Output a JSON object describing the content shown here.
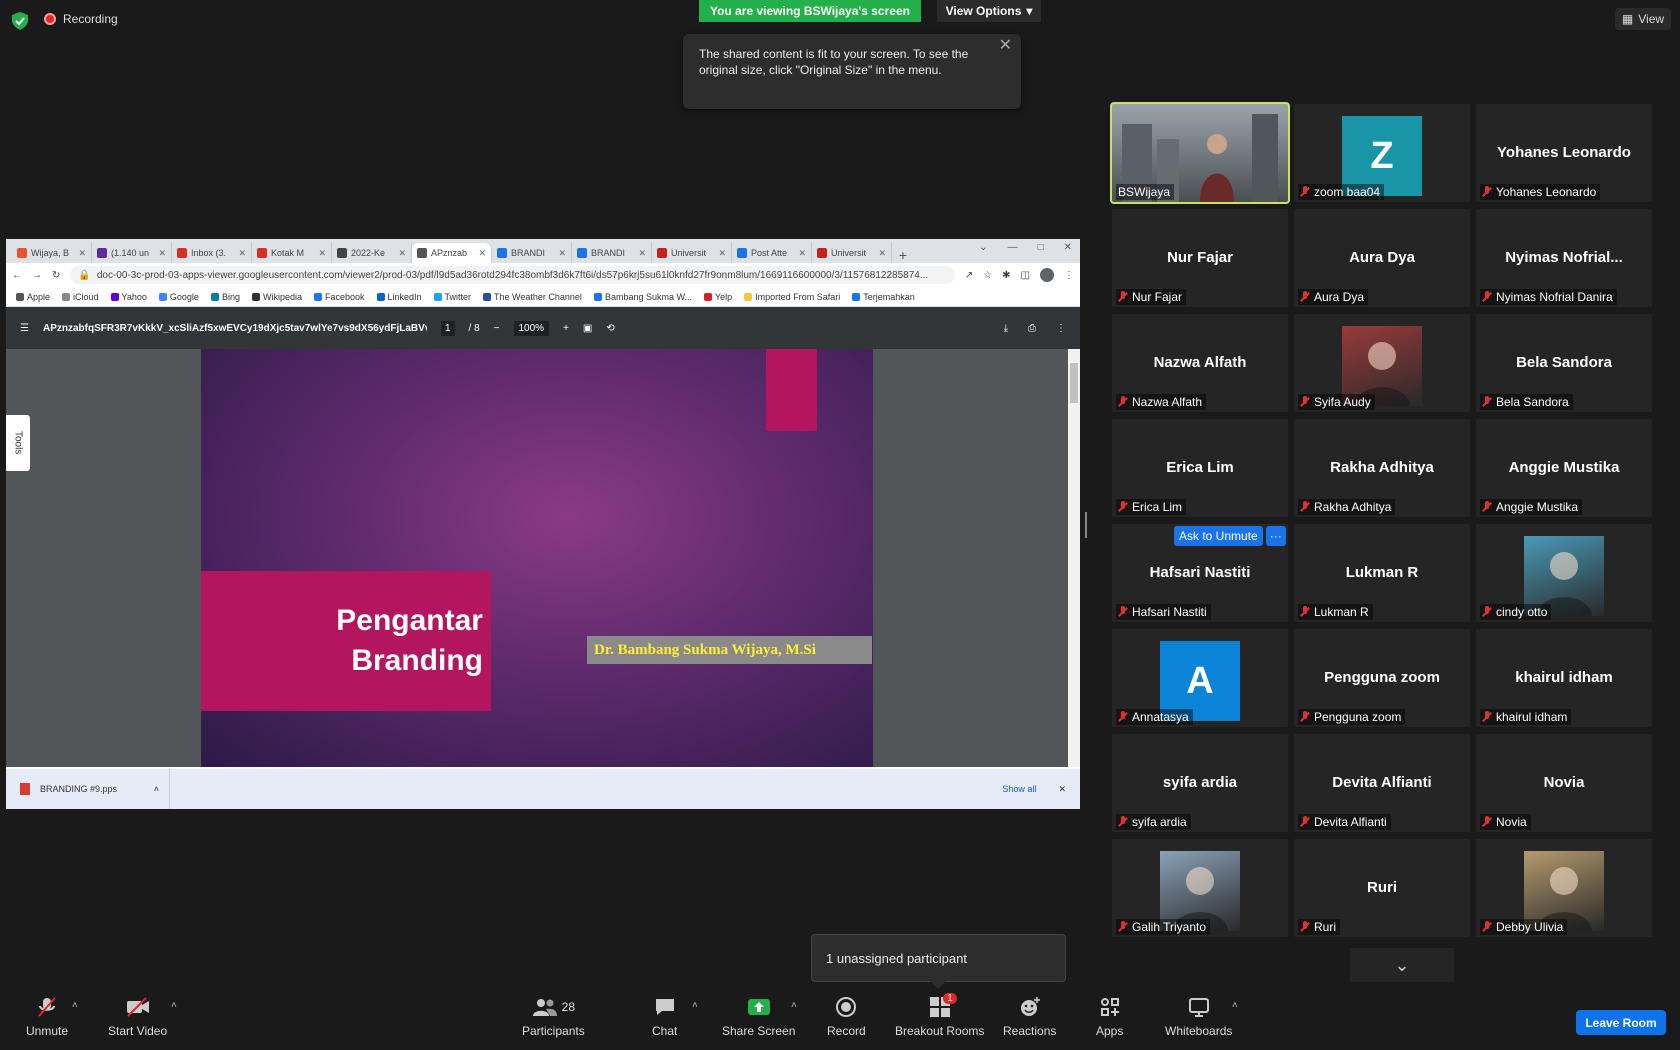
{
  "top": {
    "recording": "Recording",
    "banner": "You are viewing BSWijaya's screen",
    "view_options": "View Options",
    "tooltip": "The shared content is fit to your screen. To see the original size, click \"Original Size\" in the menu.",
    "view": "View"
  },
  "browser": {
    "tabs": [
      {
        "label": "Wijaya, B",
        "color": "#e4572e"
      },
      {
        "label": "(1.140 un",
        "color": "#5b2ca0"
      },
      {
        "label": "Inbox (3.",
        "color": "#d93025"
      },
      {
        "label": "Kotak M",
        "color": "#d93025"
      },
      {
        "label": "2022-Ke",
        "color": "#444444"
      },
      {
        "label": "APznzab",
        "color": "#555555"
      },
      {
        "label": "BRANDI",
        "color": "#1a73e8"
      },
      {
        "label": "BRANDI",
        "color": "#1a73e8"
      },
      {
        "label": "Universit",
        "color": "#c5221f"
      },
      {
        "label": "Post Atte",
        "color": "#1a73e8"
      },
      {
        "label": "Universit",
        "color": "#c5221f"
      }
    ],
    "url": "doc-00-3c-prod-03-apps-viewer.googleusercontent.com/viewer2/prod-03/pdf/l9d5ad36rotd294fc38ombf3d6k7ft6i/ds57p6krj5su61l0knfd27fr9onm8lum/1669116600000/3/11576812285874...",
    "bookmarks": [
      "Apple",
      "iCloud",
      "Yahoo",
      "Google",
      "Bing",
      "Wikipedia",
      "Facebook",
      "LinkedIn",
      "Twitter",
      "The Weather Channel",
      "Bambang Sukma W...",
      "Yelp",
      "Imported From Safari",
      "Terjemahkan"
    ]
  },
  "pdf": {
    "title": "APznzabfqSFR3R7vKkkV_xcSliAzf5xwEVCy19dXjc5tav7wlYe7vs9dX56ydFjLaBVvi...",
    "page_current": "1",
    "page_total": "/ 8",
    "zoom": "100%",
    "tools": "Tools"
  },
  "slide": {
    "title_line1": "Pengantar",
    "title_line2": "Branding",
    "author": "Dr. Bambang Sukma Wijaya, M.Si"
  },
  "download": {
    "file": "BRANDING #9.pps",
    "show_all": "Show all"
  },
  "participants": [
    {
      "big": "",
      "label": "BSWijaya",
      "muted": false,
      "type": "video",
      "active": true
    },
    {
      "big": "",
      "label": "zoom baa04",
      "muted": true,
      "type": "letter",
      "letter": "Z",
      "color": "#1896a8"
    },
    {
      "big": "Yohanes Leonardo",
      "label": "Yohanes Leonardo",
      "muted": true,
      "type": "name"
    },
    {
      "big": "Nur Fajar",
      "label": "Nur Fajar",
      "muted": true,
      "type": "name"
    },
    {
      "big": "Aura Dya",
      "label": "Aura Dya",
      "muted": true,
      "type": "name"
    },
    {
      "big": "Nyimas  Nofrial...",
      "label": "Nyimas Nofrial Danira",
      "muted": true,
      "type": "name"
    },
    {
      "big": "Nazwa Alfath",
      "label": "Nazwa Alfath",
      "muted": true,
      "type": "name"
    },
    {
      "big": "",
      "label": "Syifa Audy",
      "muted": true,
      "type": "photo",
      "color": "#9a3a3a"
    },
    {
      "big": "Bela Sandora",
      "label": "Bela Sandora",
      "muted": true,
      "type": "name"
    },
    {
      "big": "Erica Lim",
      "label": "Erica Lim",
      "muted": true,
      "type": "name"
    },
    {
      "big": "Rakha Adhitya",
      "label": "Rakha Adhitya",
      "muted": true,
      "type": "name"
    },
    {
      "big": "Anggie Mustika",
      "label": "Anggie Mustika",
      "muted": true,
      "type": "name"
    },
    {
      "big": "Hafsari Nastiti",
      "label": "Hafsari Nastiti",
      "muted": true,
      "type": "name",
      "ask": true
    },
    {
      "big": "Lukman R",
      "label": "Lukman R",
      "muted": true,
      "type": "name"
    },
    {
      "big": "",
      "label": "cindy otto",
      "muted": true,
      "type": "photo",
      "color": "#4a9ab8"
    },
    {
      "big": "",
      "label": "Annatasya",
      "muted": true,
      "type": "letter",
      "letter": "A",
      "color": "#0a84d6"
    },
    {
      "big": "Pengguna zoom",
      "label": "Pengguna zoom",
      "muted": true,
      "type": "name"
    },
    {
      "big": "khairul idham",
      "label": "khairul idham",
      "muted": true,
      "type": "name"
    },
    {
      "big": "syifa ardia",
      "label": "syifa ardia",
      "muted": true,
      "type": "name"
    },
    {
      "big": "Devita Alfianti",
      "label": "Devita Alfianti",
      "muted": true,
      "type": "name"
    },
    {
      "big": "Novia",
      "label": "Novia",
      "muted": true,
      "type": "name"
    },
    {
      "big": "",
      "label": "Galih Triyanto",
      "muted": true,
      "type": "photo",
      "color": "#8aa2b8"
    },
    {
      "big": "Ruri",
      "label": "Ruri",
      "muted": true,
      "type": "name"
    },
    {
      "big": "",
      "label": "Debby Ulivia",
      "muted": true,
      "type": "photo",
      "color": "#b59a6e"
    }
  ],
  "ask_to_unmute": "Ask to Unmute",
  "ask_more": "···",
  "unassigned": "1 unassigned participant",
  "toolbar": {
    "unmute": "Unmute",
    "start_video": "Start Video",
    "participants": "Participants",
    "participants_count": "28",
    "chat": "Chat",
    "share_screen": "Share Screen",
    "record": "Record",
    "breakout_rooms": "Breakout Rooms",
    "breakout_badge": "1",
    "reactions": "Reactions",
    "apps": "Apps",
    "whiteboards": "Whiteboards",
    "leave_room": "Leave Room"
  },
  "colors": {
    "banner_green": "#23b04a",
    "slide_magenta": "#b3165f",
    "author_yellow": "#ffee33",
    "active_speaker": "#c9e35a",
    "leave_blue": "#0e72ed"
  }
}
